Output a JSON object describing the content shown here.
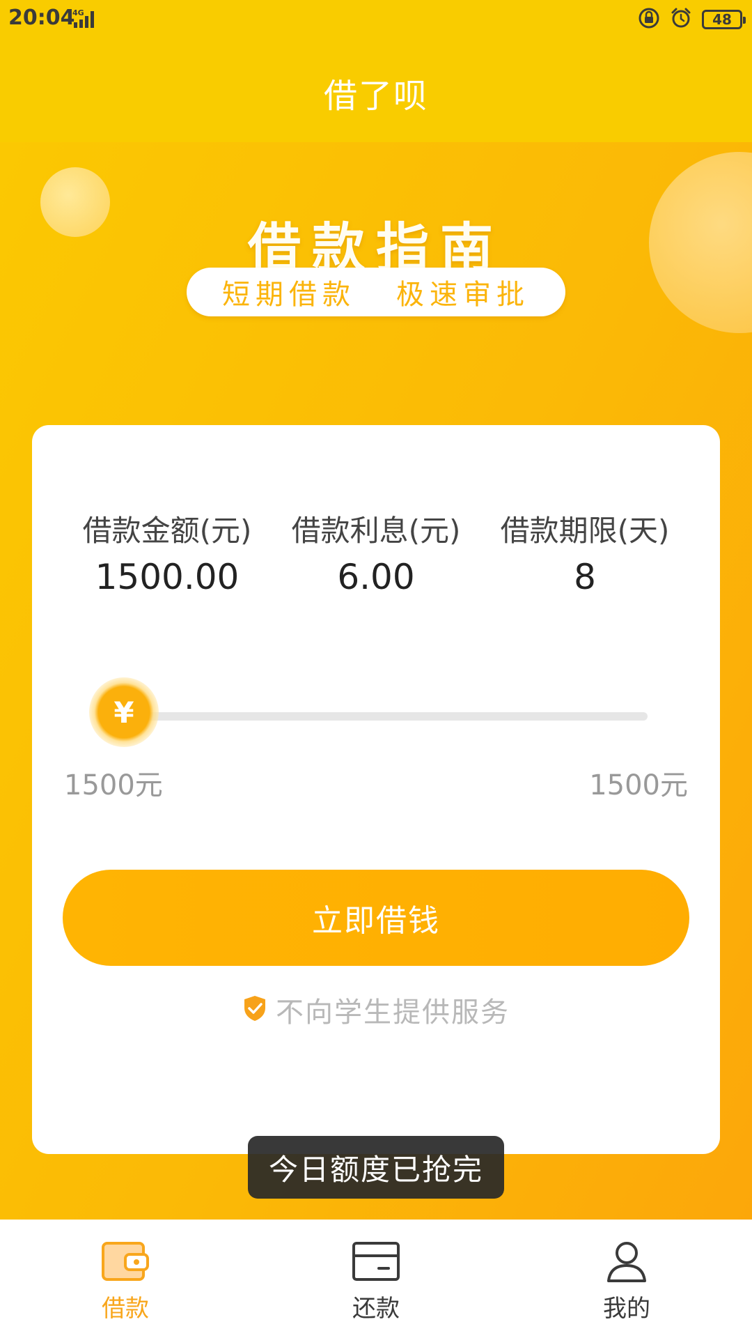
{
  "status_bar": {
    "time": "20:04",
    "network": "4G",
    "battery": "48"
  },
  "nav": {
    "title": "借了呗"
  },
  "hero": {
    "title": "借款指南",
    "tag_left": "短期借款",
    "tag_right": "极速审批"
  },
  "stats": [
    {
      "label": "借款金额(元)",
      "value": "1500.00"
    },
    {
      "label": "借款利息(元)",
      "value": "6.00"
    },
    {
      "label": "借款期限(天)",
      "value": "8"
    }
  ],
  "slider": {
    "thumb_symbol": "¥",
    "min_label": "1500元",
    "max_label": "1500元"
  },
  "borrow_button": {
    "label": "立即借钱"
  },
  "notice": {
    "text": "不向学生提供服务"
  },
  "toast": {
    "text": "今日额度已抢完"
  },
  "tabs": [
    {
      "label": "借款",
      "icon": "wallet-icon",
      "active": true
    },
    {
      "label": "还款",
      "icon": "card-icon",
      "active": false
    },
    {
      "label": "我的",
      "icon": "person-icon",
      "active": false
    }
  ],
  "colors": {
    "primary": "#FBB00C",
    "header": "#F9CC00",
    "active_tab": "#F8A61C",
    "muted_text": "#B8B8B8"
  }
}
